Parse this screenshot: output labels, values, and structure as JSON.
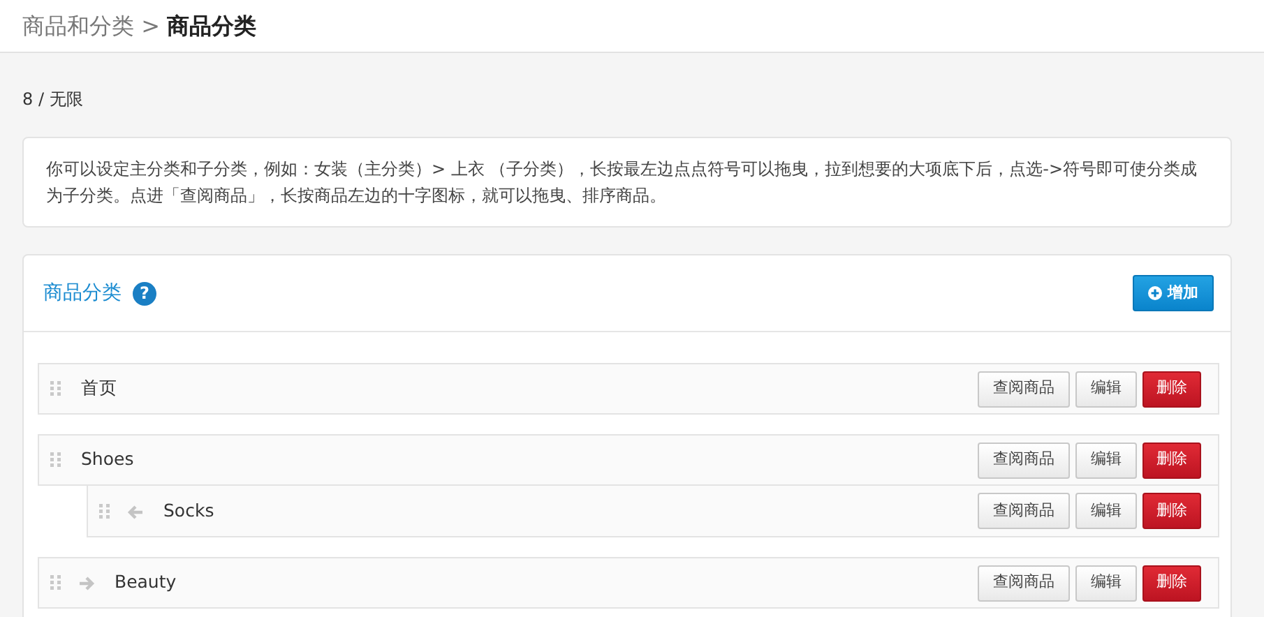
{
  "breadcrumb": {
    "parent": "商品和分类",
    "separator": ">",
    "current": "商品分类"
  },
  "quota": "8 / 无限",
  "info": "你可以设定主分类和子分类，例如：女装（主分类）> 上衣 （子分类），长按最左边点点符号可以拖曳，拉到想要的大项底下后，点选->符号即可使分类成为子分类。点进「查阅商品」，长按商品左边的十字图标，就可以拖曳、排序商品。",
  "panel": {
    "title": "商品分类",
    "help": "?",
    "add_button": "增加"
  },
  "categories": [
    {
      "name": "首页",
      "kind": "plain",
      "actions": [
        {
          "label": "查阅商品",
          "kind": "view"
        },
        {
          "label": "编辑",
          "kind": "edit"
        },
        {
          "label": "删除",
          "kind": "delete"
        }
      ]
    },
    {
      "name": "Shoes",
      "kind": "plain",
      "actions": [
        {
          "label": "查阅商品",
          "kind": "view"
        },
        {
          "label": "编辑",
          "kind": "edit"
        },
        {
          "label": "删除",
          "kind": "delete"
        }
      ],
      "children": [
        {
          "name": "Socks",
          "kind": "outdent",
          "actions": [
            {
              "label": "查阅商品",
              "kind": "view"
            },
            {
              "label": "编辑",
              "kind": "edit"
            },
            {
              "label": "删除",
              "kind": "delete"
            }
          ]
        }
      ]
    },
    {
      "name": "Beauty",
      "kind": "indent",
      "actions": [
        {
          "label": "查阅商品",
          "kind": "view"
        },
        {
          "label": "编辑",
          "kind": "edit"
        },
        {
          "label": "删除",
          "kind": "delete"
        }
      ]
    }
  ]
}
